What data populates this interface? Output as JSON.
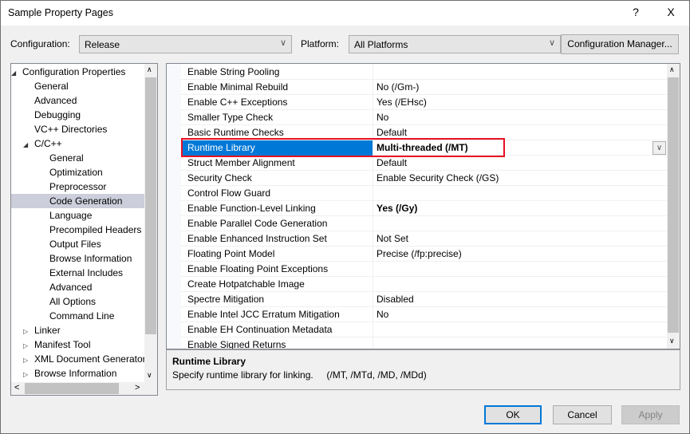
{
  "window": {
    "title": "Sample Property Pages",
    "help": "?",
    "close": "X"
  },
  "toolbar": {
    "configuration_label": "Configuration:",
    "configuration_value": "Release",
    "platform_label": "Platform:",
    "platform_value": "All Platforms",
    "config_manager": "Configuration Manager..."
  },
  "tree": {
    "items": [
      {
        "label": "Configuration Properties",
        "level": 0,
        "toggle": "expanded"
      },
      {
        "label": "General",
        "level": 1
      },
      {
        "label": "Advanced",
        "level": 1
      },
      {
        "label": "Debugging",
        "level": 1
      },
      {
        "label": "VC++ Directories",
        "level": 1
      },
      {
        "label": "C/C++",
        "level": 1,
        "toggle": "expanded"
      },
      {
        "label": "General",
        "level": 2
      },
      {
        "label": "Optimization",
        "level": 2
      },
      {
        "label": "Preprocessor",
        "level": 2
      },
      {
        "label": "Code Generation",
        "level": 2,
        "selected": true
      },
      {
        "label": "Language",
        "level": 2
      },
      {
        "label": "Precompiled Headers",
        "level": 2
      },
      {
        "label": "Output Files",
        "level": 2
      },
      {
        "label": "Browse Information",
        "level": 2
      },
      {
        "label": "External Includes",
        "level": 2
      },
      {
        "label": "Advanced",
        "level": 2
      },
      {
        "label": "All Options",
        "level": 2
      },
      {
        "label": "Command Line",
        "level": 2
      },
      {
        "label": "Linker",
        "level": 1,
        "toggle": "collapsed"
      },
      {
        "label": "Manifest Tool",
        "level": 1,
        "toggle": "collapsed"
      },
      {
        "label": "XML Document Generator",
        "level": 1,
        "toggle": "collapsed"
      },
      {
        "label": "Browse Information",
        "level": 1,
        "toggle": "collapsed"
      }
    ]
  },
  "properties": [
    {
      "name": "Enable String Pooling",
      "value": ""
    },
    {
      "name": "Enable Minimal Rebuild",
      "value": "No (/Gm-)"
    },
    {
      "name": "Enable C++ Exceptions",
      "value": "Yes (/EHsc)"
    },
    {
      "name": "Smaller Type Check",
      "value": "No"
    },
    {
      "name": "Basic Runtime Checks",
      "value": "Default"
    },
    {
      "name": "Runtime Library",
      "value": "Multi-threaded (/MT)",
      "selected": true
    },
    {
      "name": "Struct Member Alignment",
      "value": "Default"
    },
    {
      "name": "Security Check",
      "value": "Enable Security Check (/GS)"
    },
    {
      "name": "Control Flow Guard",
      "value": ""
    },
    {
      "name": "Enable Function-Level Linking",
      "value": "Yes (/Gy)",
      "bold": true
    },
    {
      "name": "Enable Parallel Code Generation",
      "value": ""
    },
    {
      "name": "Enable Enhanced Instruction Set",
      "value": "Not Set"
    },
    {
      "name": "Floating Point Model",
      "value": "Precise (/fp:precise)"
    },
    {
      "name": "Enable Floating Point Exceptions",
      "value": ""
    },
    {
      "name": "Create Hotpatchable Image",
      "value": ""
    },
    {
      "name": "Spectre Mitigation",
      "value": "Disabled"
    },
    {
      "name": "Enable Intel JCC Erratum Mitigation",
      "value": "No"
    },
    {
      "name": "Enable EH Continuation Metadata",
      "value": ""
    },
    {
      "name": "Enable Signed Returns",
      "value": ""
    }
  ],
  "description": {
    "title": "Runtime Library",
    "text": "Specify runtime library for linking.     (/MT, /MTd, /MD, /MDd)"
  },
  "buttons": {
    "ok": "OK",
    "cancel": "Cancel",
    "apply": "Apply"
  },
  "colors": {
    "selection": "#0078d7",
    "highlight_box": "#e81123",
    "tree_selection": "#cccedb"
  }
}
